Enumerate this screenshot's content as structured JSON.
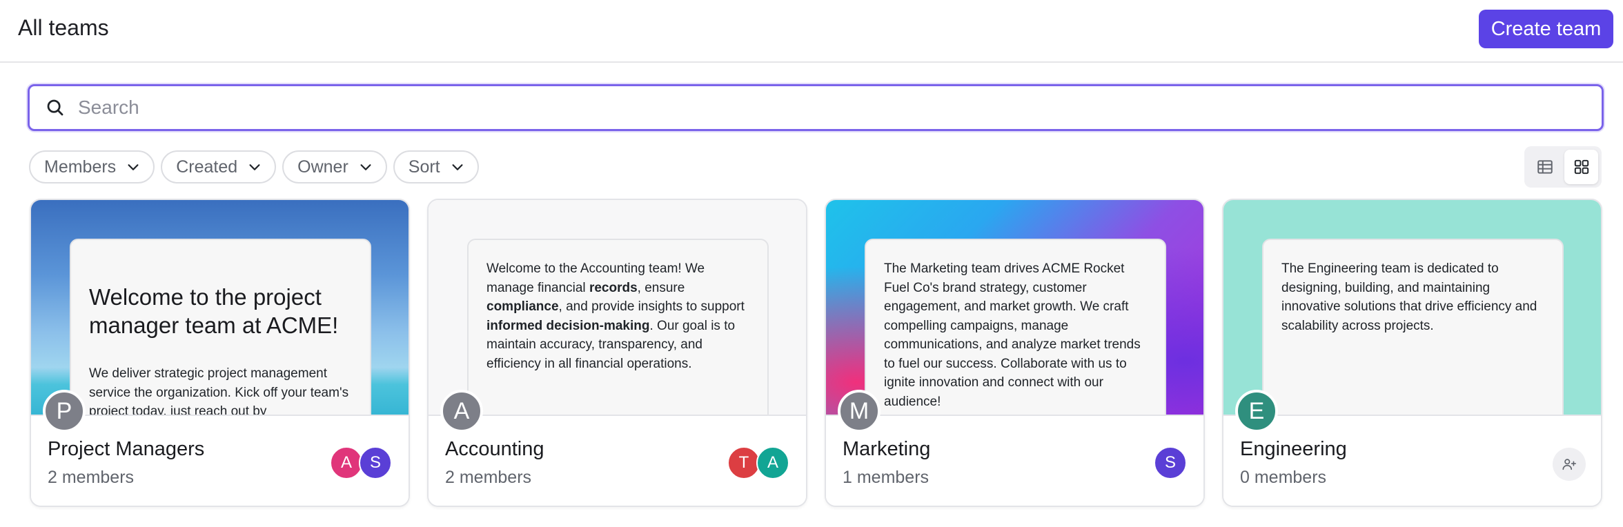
{
  "header": {
    "title": "All teams",
    "create_label": "Create team"
  },
  "search": {
    "placeholder": "Search"
  },
  "filters": [
    {
      "label": "Members"
    },
    {
      "label": "Created"
    },
    {
      "label": "Owner"
    },
    {
      "label": "Sort"
    }
  ],
  "view_toggle": {
    "options": [
      "table-icon",
      "grid-icon"
    ],
    "active": "grid"
  },
  "colors": {
    "accent": "#5b43e6",
    "avatar_gray": "#7d7f88",
    "avatar_teal_dark": "#2f8f7e",
    "member_pink": "#e0357a",
    "member_purple": "#5a3fd6",
    "member_red": "#dc3e42",
    "member_teal": "#12a594"
  },
  "teams": [
    {
      "name": "Project Managers",
      "members_text": "2 members",
      "initial": "P",
      "note": {
        "title": "Welcome to the project manager team at ACME!",
        "body": "We deliver strategic project management service the organization. Kick off your team's project today, just reach out by"
      },
      "members": [
        {
          "initial": "A",
          "color": "#e0357a"
        },
        {
          "initial": "S",
          "color": "#5a3fd6"
        }
      ]
    },
    {
      "name": "Accounting",
      "members_text": "2 members",
      "initial": "A",
      "note": {
        "body_parts": [
          "Welcome to the Accounting team! We manage financial ",
          "records",
          ", ensure ",
          "compliance",
          ", and provide insights to support ",
          "informed decision-making",
          ". Our goal is to maintain accuracy, transparency, and efficiency in all financial operations."
        ]
      },
      "members": [
        {
          "initial": "T",
          "color": "#dc3e42"
        },
        {
          "initial": "A",
          "color": "#12a594"
        }
      ]
    },
    {
      "name": "Marketing",
      "members_text": "1 members",
      "initial": "M",
      "note": {
        "body": "The Marketing team drives ACME Rocket Fuel Co's brand strategy, customer engagement, and market growth. We craft compelling campaigns, manage communications, and analyze market trends to fuel our success. Collaborate with us to ignite innovation and connect with our audience!"
      },
      "members": [
        {
          "initial": "S",
          "color": "#5a3fd6"
        }
      ]
    },
    {
      "name": "Engineering",
      "members_text": "0 members",
      "initial": "E",
      "note": {
        "body": "The Engineering team is dedicated to designing, building, and maintaining innovative solutions that drive efficiency and scalability across projects."
      },
      "members": []
    }
  ]
}
